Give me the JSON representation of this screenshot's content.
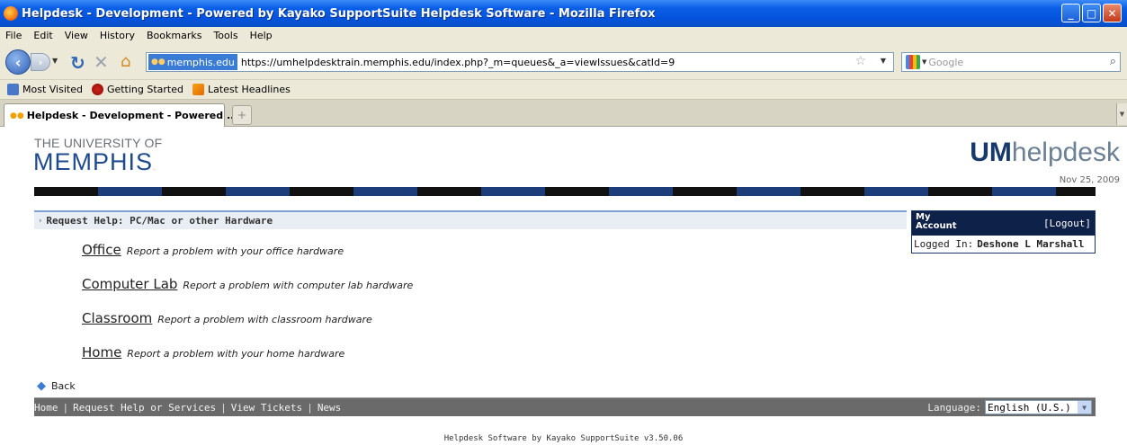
{
  "window": {
    "title": "Helpdesk - Development - Powered by Kayako SupportSuite Helpdesk Software - Mozilla Firefox"
  },
  "menu": [
    "File",
    "Edit",
    "View",
    "History",
    "Bookmarks",
    "Tools",
    "Help"
  ],
  "nav": {
    "site_identity": "memphis.edu",
    "url": "https://umhelpdesktrain.memphis.edu/index.php?_m=queues&_a=viewIssues&catId=9",
    "search_placeholder": "Google"
  },
  "bookmarks": [
    "Most Visited",
    "Getting Started",
    "Latest Headlines"
  ],
  "tab": {
    "label": "Helpdesk - Development - Powered ..."
  },
  "page": {
    "university_top": "THE UNIVERSITY OF",
    "university_main": "MEMPHIS",
    "brand_bold": "UM",
    "brand_rest": "helpdesk",
    "date": "Nov 25, 2009",
    "section_title": "Request Help: PC/Mac or other Hardware",
    "categories": [
      {
        "name": "Office",
        "description": "Report a problem with your office hardware"
      },
      {
        "name": "Computer Lab",
        "description": "Report a problem with computer lab hardware"
      },
      {
        "name": "Classroom",
        "description": "Report a problem with classroom hardware"
      },
      {
        "name": "Home",
        "description": "Report a problem with your home hardware"
      }
    ],
    "back_label": "Back"
  },
  "account": {
    "title_line1": "My",
    "title_line2": "Account",
    "logout": "[Logout]",
    "logged_in_label": "Logged In:",
    "user": "Deshone L Marshall"
  },
  "footer": {
    "links": [
      "Home",
      "Request Help or Services",
      "View Tickets",
      "News"
    ],
    "language_label": "Language:",
    "language_value": "English (U.S.)",
    "powered_by": "Helpdesk Software by Kayako SupportSuite v3.50.06"
  }
}
